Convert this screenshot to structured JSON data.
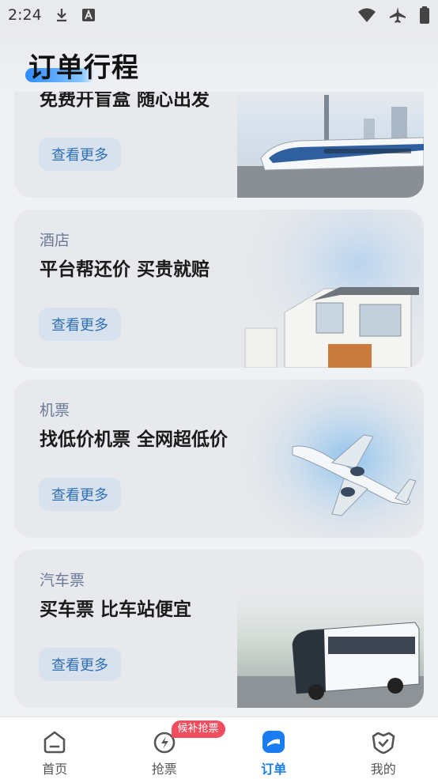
{
  "status_bar": {
    "time": "2:24"
  },
  "header": {
    "title": "订单行程"
  },
  "cards": [
    {
      "category": "",
      "slogan": "免费开盲盒 随心出发",
      "button": "查看更多",
      "image": "high-speed-train"
    },
    {
      "category": "酒店",
      "slogan": "平台帮还价 买贵就赔",
      "button": "查看更多",
      "image": "modern-house"
    },
    {
      "category": "机票",
      "slogan": "找低价机票 全网超低价",
      "button": "查看更多",
      "image": "airplane"
    },
    {
      "category": "汽车票",
      "slogan": "买车票 比车站便宜",
      "button": "查看更多",
      "image": "coach-bus"
    }
  ],
  "nav": {
    "items": [
      {
        "label": "首页",
        "icon": "home-icon"
      },
      {
        "label": "抢票",
        "icon": "grab-ticket-icon",
        "badge": "候补抢票"
      },
      {
        "label": "订单",
        "icon": "order-icon",
        "active": true
      },
      {
        "label": "我的",
        "icon": "profile-icon"
      }
    ]
  },
  "colors": {
    "accent": "#1a7cf0",
    "badge": "#f04e5e",
    "button_bg": "#d8e2ef",
    "button_text": "#2f6fb5"
  }
}
